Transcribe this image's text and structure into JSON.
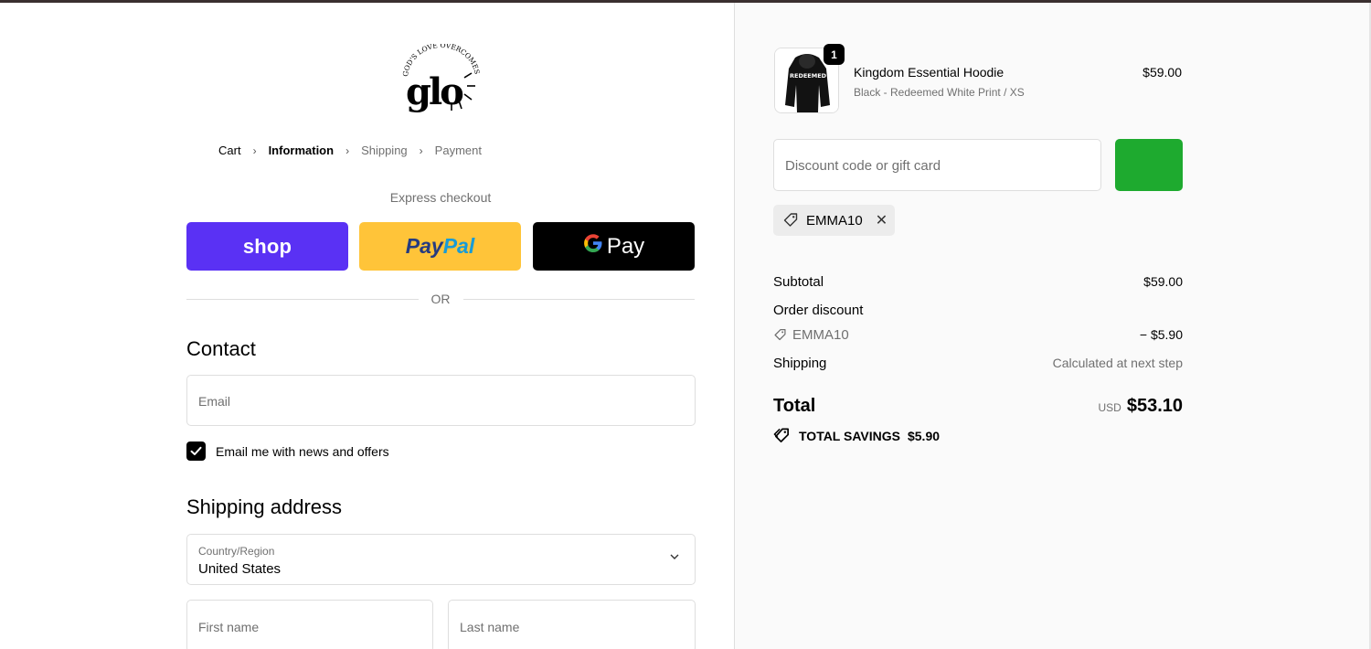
{
  "brand": {
    "logo_text": "glo",
    "logo_arc": "GOD'S LOVE OVERCOMES"
  },
  "breadcrumb": [
    {
      "label": "Cart"
    },
    {
      "label": "Information"
    },
    {
      "label": "Shipping"
    },
    {
      "label": "Payment"
    }
  ],
  "express": {
    "title": "Express checkout",
    "shop_label": "shop",
    "paypal_label_1": "Pay",
    "paypal_label_2": "Pal",
    "gpay_g": "G",
    "gpay_label": "Pay",
    "or_label": "OR"
  },
  "contact": {
    "title": "Contact",
    "email_placeholder": "Email",
    "newsletter_label": "Email me with news and offers",
    "newsletter_checked": true
  },
  "shipping": {
    "title": "Shipping address",
    "country_label": "Country/Region",
    "country_value": "United States",
    "first_name_placeholder": "First name",
    "last_name_placeholder": "Last name"
  },
  "cart": {
    "item": {
      "quantity": "1",
      "name": "Kingdom Essential Hoodie",
      "variant": "Black - Redeemed White Print / XS",
      "price": "$59.00",
      "print_text": "REDEEMED"
    },
    "discount_placeholder": "Discount code or gift card",
    "applied_code": "EMMA10",
    "apply_color": "#1eaa2f"
  },
  "summary": {
    "subtotal_label": "Subtotal",
    "subtotal_value": "$59.00",
    "order_discount_label": "Order discount",
    "discount_code": "EMMA10",
    "discount_value": "− $5.90",
    "shipping_label": "Shipping",
    "shipping_value": "Calculated at next step",
    "total_label": "Total",
    "total_currency": "USD",
    "total_value": "$53.10",
    "savings_label": "TOTAL SAVINGS",
    "savings_value": "$5.90"
  }
}
